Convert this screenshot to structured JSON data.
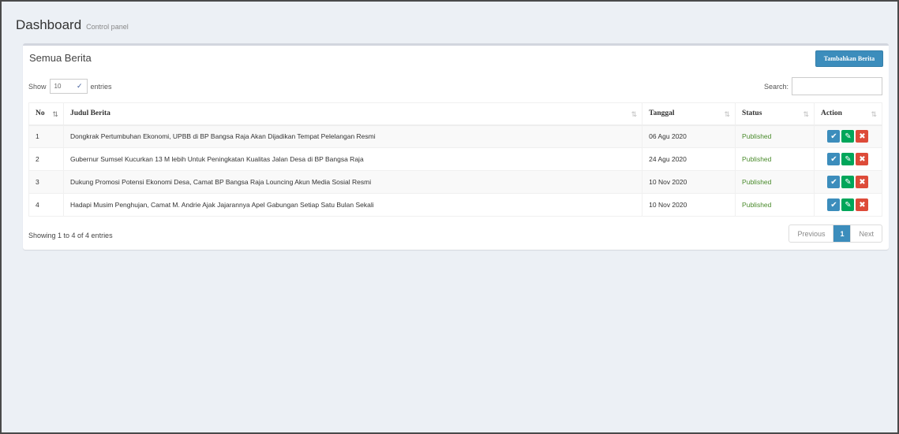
{
  "header": {
    "title": "Dashboard",
    "subtitle": "Control panel"
  },
  "box": {
    "title": "Semua Berita",
    "add_button": "Tambahkan Berita"
  },
  "length": {
    "show": "Show",
    "value": "10",
    "entries": "entries"
  },
  "search": {
    "label": "Search:",
    "value": ""
  },
  "table": {
    "columns": [
      "No",
      "Judul Berita",
      "Tanggal",
      "Status",
      "Action"
    ],
    "rows": [
      {
        "no": "1",
        "judul": "Dongkrak Pertumbuhan Ekonomi, UPBB di BP Bangsa Raja Akan Dijadikan Tempat Pelelangan Resmi",
        "tanggal": "06 Agu 2020",
        "status": "Published"
      },
      {
        "no": "2",
        "judul": "Gubernur Sumsel Kucurkan 13 M lebih Untuk Peningkatan Kualitas Jalan Desa di BP Bangsa Raja",
        "tanggal": "24 Agu 2020",
        "status": "Published"
      },
      {
        "no": "3",
        "judul": "Dukung Promosi Potensi Ekonomi Desa, Camat BP Bangsa Raja Louncing Akun Media Sosial Resmi",
        "tanggal": "10 Nov 2020",
        "status": "Published"
      },
      {
        "no": "4",
        "judul": "Hadapi Musim Penghujan, Camat M. Andrie Ajak Jajarannya Apel Gabungan Setiap Satu Bulan Sekali",
        "tanggal": "10 Nov 2020",
        "status": "Published"
      }
    ]
  },
  "footer": {
    "info": "Showing 1 to 4 of 4 entries",
    "previous": "Previous",
    "current_page": "1",
    "next": "Next"
  },
  "icons": {
    "check": "check-icon",
    "edit": "edit-icon",
    "delete": "delete-icon"
  },
  "colors": {
    "primary": "#3c8dbc",
    "success": "#00a65a",
    "danger": "#dd4b39",
    "status_text": "#4a8b2c"
  }
}
